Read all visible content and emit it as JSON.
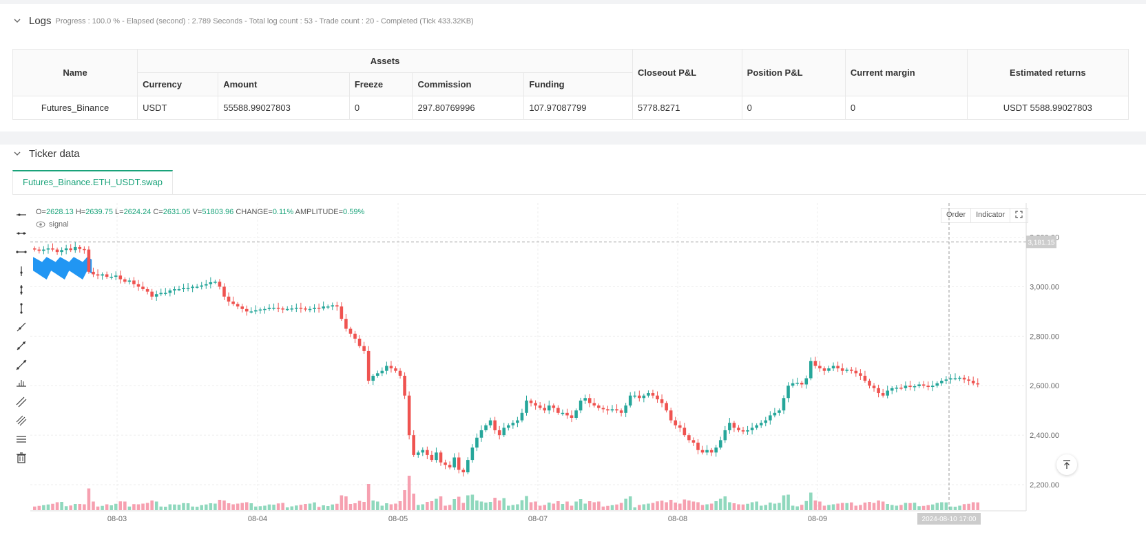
{
  "logs": {
    "title": "Logs",
    "progress": "Progress : 100.0 % - Elapsed (second) : 2.789  Seconds - Total log count : 53 - Trade count : 20 - Completed (Tick 433.32KB)",
    "headers": {
      "name": "Name",
      "assets": "Assets",
      "currency": "Currency",
      "amount": "Amount",
      "freeze": "Freeze",
      "commission": "Commission",
      "funding": "Funding",
      "closeout": "Closeout P&L",
      "position": "Position P&L",
      "margin": "Current margin",
      "returns": "Estimated returns"
    },
    "row": {
      "name": "Futures_Binance",
      "currency": "USDT",
      "amount": "55588.99027803",
      "freeze": "0",
      "commission": "297.80769996",
      "funding": "107.97087799",
      "closeout": "5778.8271",
      "position": "0",
      "margin": "0",
      "returns": "USDT 5588.99027803"
    }
  },
  "ticker": {
    "title": "Ticker data",
    "tab": "Futures_Binance.ETH_USDT.swap",
    "ohlc": {
      "o_label": "O=",
      "o": "2628.13",
      "h_label": "H=",
      "h": "2639.75",
      "l_label": "L=",
      "l": "2624.24",
      "c_label": "C=",
      "c": "2631.05",
      "v_label": "V=",
      "v": "51803.96",
      "change_label": "CHANGE=",
      "change": "0.11%",
      "amp_label": "AMPLITUDE=",
      "amp": "0.59%"
    },
    "signal_label": "signal",
    "buttons": {
      "order": "Order",
      "indicator": "Indicator"
    },
    "crosshair_price": "3,181.15",
    "crosshair_time": "2024-08-10 17:00"
  },
  "colors": {
    "up": "#26a69a",
    "down": "#ef5350",
    "accent": "#1aa37a",
    "signal": "#2196f3"
  },
  "chart_data": {
    "type": "candlestick",
    "y_ticks": [
      "2,200.00",
      "2,400.00",
      "2,600.00",
      "2,800.00",
      "3,000.00",
      "3,200.00"
    ],
    "y_tick_values": [
      2200,
      2400,
      2600,
      2800,
      3000,
      3200
    ],
    "x_ticks": [
      "08-03",
      "08-04",
      "08-05",
      "08-07",
      "08-08",
      "08-09"
    ],
    "ylim": [
      2100,
      3310
    ],
    "closes": [
      3150,
      3145,
      3150,
      3155,
      3150,
      3140,
      3148,
      3155,
      3148,
      3160,
      3152,
      3150,
      3060,
      3050,
      3045,
      3050,
      3040,
      3040,
      3045,
      3030,
      3020,
      3025,
      3010,
      3000,
      2990,
      2980,
      2960,
      2970,
      2975,
      2975,
      2985,
      2990,
      2990,
      2995,
      2995,
      3000,
      3000,
      3005,
      3010,
      3018,
      3020,
      3000,
      2960,
      2940,
      2930,
      2920,
      2910,
      2900,
      2900,
      2905,
      2908,
      2910,
      2915,
      2915,
      2912,
      2910,
      2910,
      2912,
      2915,
      2912,
      2908,
      2910,
      2915,
      2912,
      2920,
      2920,
      2925,
      2920,
      2870,
      2830,
      2810,
      2790,
      2760,
      2740,
      2620,
      2640,
      2650,
      2660,
      2680,
      2670,
      2660,
      2640,
      2560,
      2400,
      2320,
      2330,
      2340,
      2320,
      2300,
      2330,
      2290,
      2280,
      2270,
      2310,
      2260,
      2250,
      2300,
      2350,
      2390,
      2420,
      2440,
      2460,
      2420,
      2400,
      2430,
      2440,
      2450,
      2460,
      2490,
      2540,
      2530,
      2520,
      2510,
      2500,
      2520,
      2510,
      2490,
      2490,
      2480,
      2470,
      2500,
      2540,
      2550,
      2530,
      2520,
      2510,
      2505,
      2500,
      2505,
      2500,
      2490,
      2520,
      2560,
      2560,
      2550,
      2560,
      2570,
      2560,
      2545,
      2530,
      2500,
      2460,
      2440,
      2430,
      2400,
      2380,
      2370,
      2340,
      2330,
      2340,
      2330,
      2350,
      2380,
      2420,
      2450,
      2430,
      2420,
      2415,
      2420,
      2430,
      2440,
      2450,
      2460,
      2480,
      2490,
      2500,
      2550,
      2600,
      2610,
      2612,
      2605,
      2630,
      2700,
      2680,
      2670,
      2660,
      2670,
      2680,
      2670,
      2660,
      2665,
      2660,
      2650,
      2640,
      2620,
      2600,
      2590,
      2570,
      2560,
      2580,
      2590,
      2592,
      2590,
      2600,
      2595,
      2598,
      2605,
      2600,
      2595,
      2600,
      2610,
      2620,
      2625,
      2630,
      2630,
      2632,
      2625,
      2620,
      2610,
      2605
    ]
  }
}
